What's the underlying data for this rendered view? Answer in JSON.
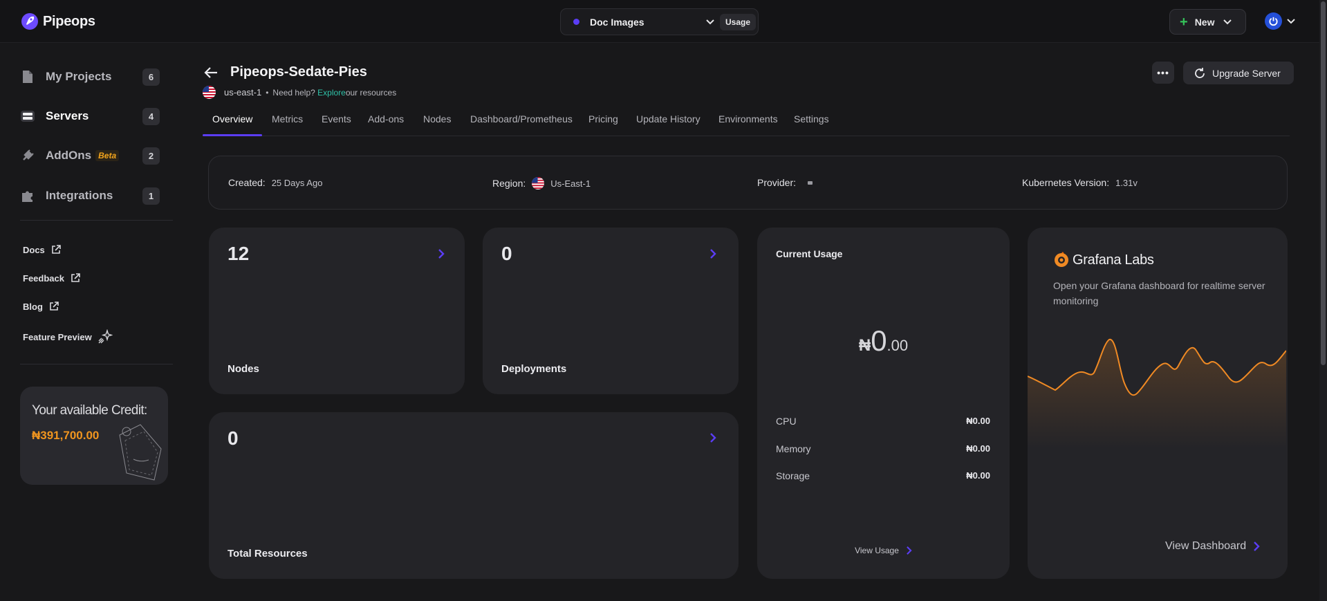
{
  "app": {
    "name": "Pipeops"
  },
  "topbar": {
    "project_name": "Doc Images",
    "usage_label": "Usage",
    "new_label": "New"
  },
  "sidebar": {
    "items": [
      {
        "label": "My Projects",
        "count": "6",
        "icon": "file-icon"
      },
      {
        "label": "Servers",
        "count": "4",
        "icon": "server-icon"
      },
      {
        "label": "AddOns",
        "badge": "Beta",
        "count": "2",
        "icon": "plug-icon"
      },
      {
        "label": "Integrations",
        "count": "1",
        "icon": "puzzle-icon"
      }
    ],
    "links": [
      {
        "label": "Docs",
        "icon": "external-link-icon"
      },
      {
        "label": "Feedback",
        "icon": "external-link-icon"
      },
      {
        "label": "Blog",
        "icon": "external-link-icon"
      },
      {
        "label": "Feature Preview",
        "icon": "sparkle-icon"
      }
    ],
    "credit": {
      "title": "Your available Credit:",
      "amount": "₦391,700.00"
    }
  },
  "header": {
    "title": "Pipeops-Sedate-Pies",
    "region": "us-east-1",
    "help_prefix": "Need help?",
    "help_link": "Explore",
    "help_suffix": "our resources",
    "more_label": "•••",
    "upgrade_label": "Upgrade Server"
  },
  "tabs": [
    "Overview",
    "Metrics",
    "Events",
    "Add-ons",
    "Nodes",
    "Dashboard/Prometheus",
    "Pricing",
    "Update History",
    "Environments",
    "Settings"
  ],
  "active_tab": "Overview",
  "info": {
    "created_label": "Created:",
    "created_value": "25 Days Ago",
    "region_label": "Region:",
    "region_value": "Us-East-1",
    "provider_label": "Provider:",
    "k8s_label": "Kubernetes Version:",
    "k8s_value": "1.31v"
  },
  "cards": {
    "nodes": {
      "value": "12",
      "label": "Nodes"
    },
    "deployments": {
      "value": "0",
      "label": "Deployments"
    },
    "resources": {
      "value": "0",
      "label": "Total Resources"
    }
  },
  "usage": {
    "title": "Current Usage",
    "currency": "₦",
    "total_int": "0",
    "total_dec": ".00",
    "rows": [
      {
        "label": "CPU",
        "value": "₦0.00"
      },
      {
        "label": "Memory",
        "value": "₦0.00"
      },
      {
        "label": "Storage",
        "value": "₦0.00"
      }
    ],
    "view_label": "View Usage"
  },
  "grafana": {
    "brand": "Grafana Labs",
    "description": "Open your Grafana dashboard for realtime server monitoring",
    "view_label": "View Dashboard"
  },
  "colors": {
    "accent": "#5b3df5",
    "credit": "#f0951f",
    "grafana": "#f08a24",
    "link": "#2fc2a8"
  }
}
